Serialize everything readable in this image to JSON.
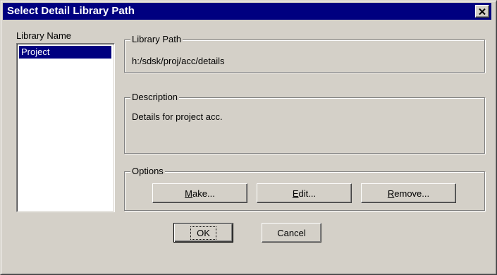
{
  "window": {
    "title": "Select Detail Library Path",
    "close_icon": "close-icon"
  },
  "library_list": {
    "label": "Library Name",
    "items": [
      {
        "label": "Project",
        "selected": true
      }
    ]
  },
  "library_path": {
    "legend": "Library Path",
    "value": "h:/sdsk/proj/acc/details"
  },
  "description": {
    "legend": "Description",
    "value": "Details for project acc."
  },
  "options": {
    "legend": "Options",
    "make_label_accel": "M",
    "make_label_rest": "ake...",
    "edit_label_accel": "E",
    "edit_label_rest": "dit...",
    "remove_label_accel": "R",
    "remove_label_rest": "emove..."
  },
  "footer": {
    "ok_label": "OK",
    "cancel_label": "Cancel"
  },
  "background": {
    "fragment_1": "e",
    "fragment_2": "."
  },
  "colors": {
    "titlebar": "#000080",
    "face": "#d4d0c8",
    "selection": "#000080"
  }
}
